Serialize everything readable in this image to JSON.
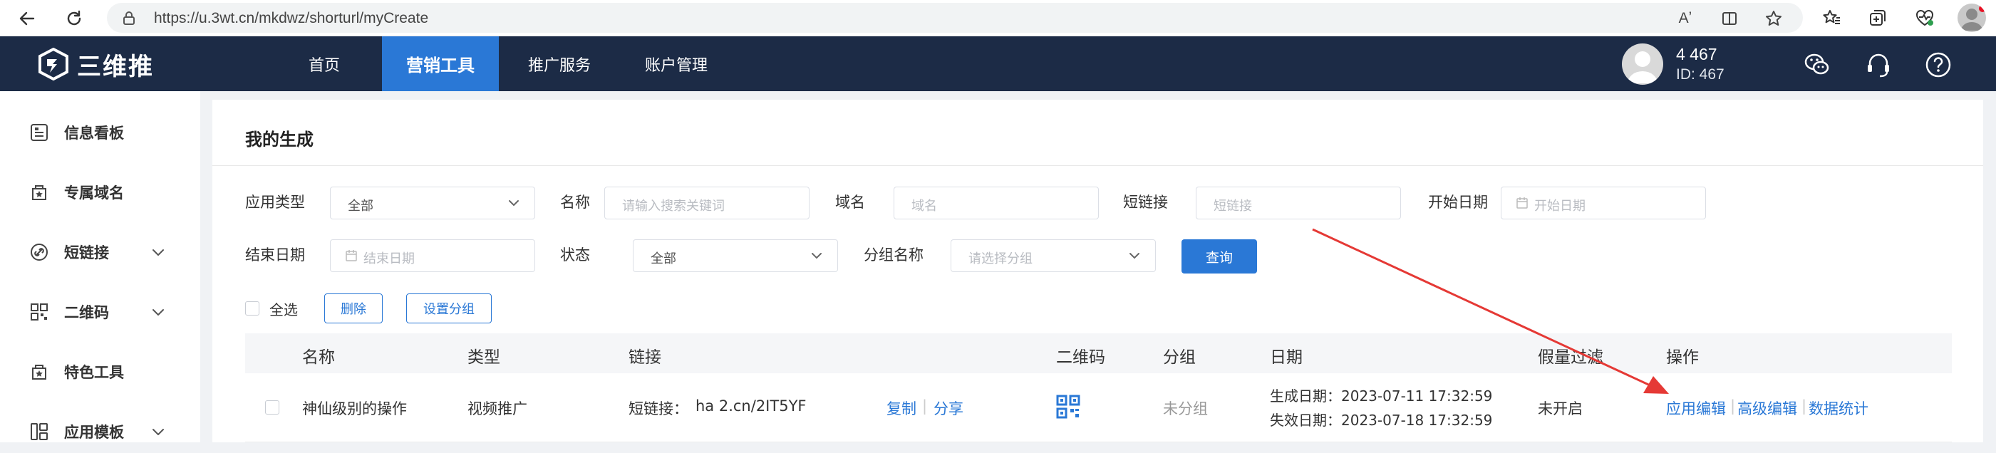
{
  "browser": {
    "url": "https://u.3wt.cn/mkdwz/shorturl/myCreate",
    "read_aloud_label": "Aʼ"
  },
  "header": {
    "logo_text": "三维推",
    "nav": [
      {
        "label": "首页"
      },
      {
        "label": "营销工具"
      },
      {
        "label": "推广服务"
      },
      {
        "label": "账户管理"
      }
    ],
    "user_name": "4   467",
    "user_id": "ID:    467"
  },
  "sidebar": {
    "items": [
      {
        "label": "信息看板",
        "icon": "dashboard-icon"
      },
      {
        "label": "专属域名",
        "icon": "domain-star-icon"
      },
      {
        "label": "短链接",
        "icon": "link-icon"
      },
      {
        "label": "二维码",
        "icon": "qrcode-icon"
      },
      {
        "label": "特色工具",
        "icon": "tools-star-icon"
      },
      {
        "label": "应用模板",
        "icon": "template-icon"
      }
    ]
  },
  "page": {
    "title": "我的生成",
    "filters": {
      "app_type_label": "应用类型",
      "app_type_value": "全部",
      "name_label": "名称",
      "name_placeholder": "请输入搜索关键词",
      "domain_label": "域名",
      "domain_placeholder": "域名",
      "short_link_label": "短链接",
      "short_link_placeholder": "短链接",
      "start_date_label": "开始日期",
      "start_date_placeholder": "开始日期",
      "end_date_label": "结束日期",
      "end_date_placeholder": "结束日期",
      "status_label": "状态",
      "status_value": "全部",
      "group_label": "分组名称",
      "group_placeholder": "请选择分组",
      "query_button": "查询"
    },
    "actions": {
      "select_all": "全选",
      "delete": "删除",
      "set_group": "设置分组"
    },
    "table": {
      "headers": [
        "名称",
        "类型",
        "链接",
        "二维码",
        "分组",
        "日期",
        "假量过滤",
        "操作"
      ],
      "rows": [
        {
          "name": "神仙级别的操作",
          "type": "视频推广",
          "link_prefix": "短链接：",
          "link_value": "ha    2.cn/2IT5YF",
          "copy": "复制",
          "share": "分享",
          "group": "未分组",
          "created": "生成日期：2023-07-11 17:32:59",
          "expires": "失效日期：2023-07-18 17:32:59",
          "filter": "未开启",
          "ops": [
            "应用编辑",
            "高级编辑",
            "数据统计"
          ]
        }
      ]
    }
  },
  "colors": {
    "nav_bg": "#1c2b46",
    "accent": "#2a78d6",
    "annotation_arrow": "#e53935"
  }
}
